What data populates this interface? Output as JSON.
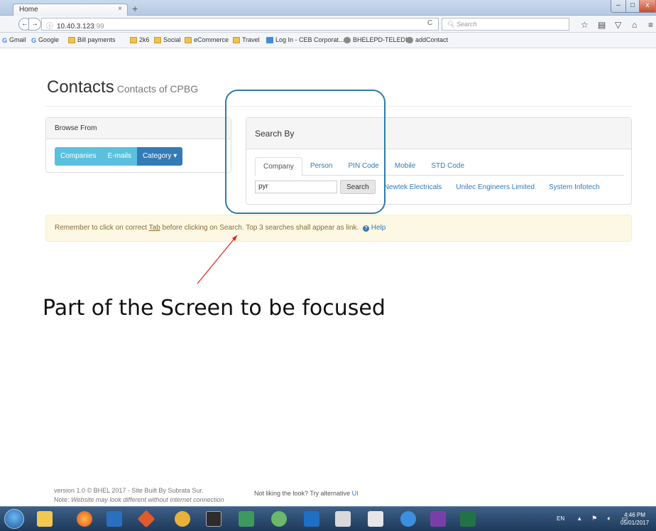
{
  "browser": {
    "tab_title": "Home",
    "url_host": "10.40.3.123",
    "url_port": ":99",
    "search_placeholder": "Search"
  },
  "bookmarks": [
    "Gmail",
    "Google",
    "Bill payments",
    "2k6",
    "Social",
    "eCommerce",
    "Travel",
    "Log In - CEB Corporat...",
    "BHELEPD-TELEDIR",
    "addContact"
  ],
  "page": {
    "title": "Contacts",
    "subtitle": "Contacts of CPBG"
  },
  "browse": {
    "heading": "Browse From",
    "buttons": [
      "Companies",
      "E-mails",
      "Category ▾"
    ]
  },
  "search": {
    "heading": "Search By",
    "tabs": [
      "Company",
      "Person",
      "PIN Code",
      "Mobile",
      "STD Code"
    ],
    "input_value": "pyr",
    "button": "Search",
    "top_results": [
      "Newtek Electricals",
      "Unilec Engineers Limited",
      "System Infotech"
    ]
  },
  "alert": {
    "before": "Remember to click on correct ",
    "tab_word": "Tab",
    "after": " before clicking on Search. Top 3 searches shall appear as link.",
    "help": "Help"
  },
  "annotation": {
    "caption": "Part of the Screen to be focused"
  },
  "footer": {
    "line1": "version 1.0 © BHEL 2017 - Site Built By Subrata Sur.",
    "note_label": "Note:",
    "note_text": "Website may look different without internet connection",
    "alt_text": "Not liking the look? Try alternative",
    "alt_link": "UI"
  },
  "taskbar": {
    "lang": "EN",
    "time": "4:46 PM",
    "date": "05/01/2017"
  }
}
